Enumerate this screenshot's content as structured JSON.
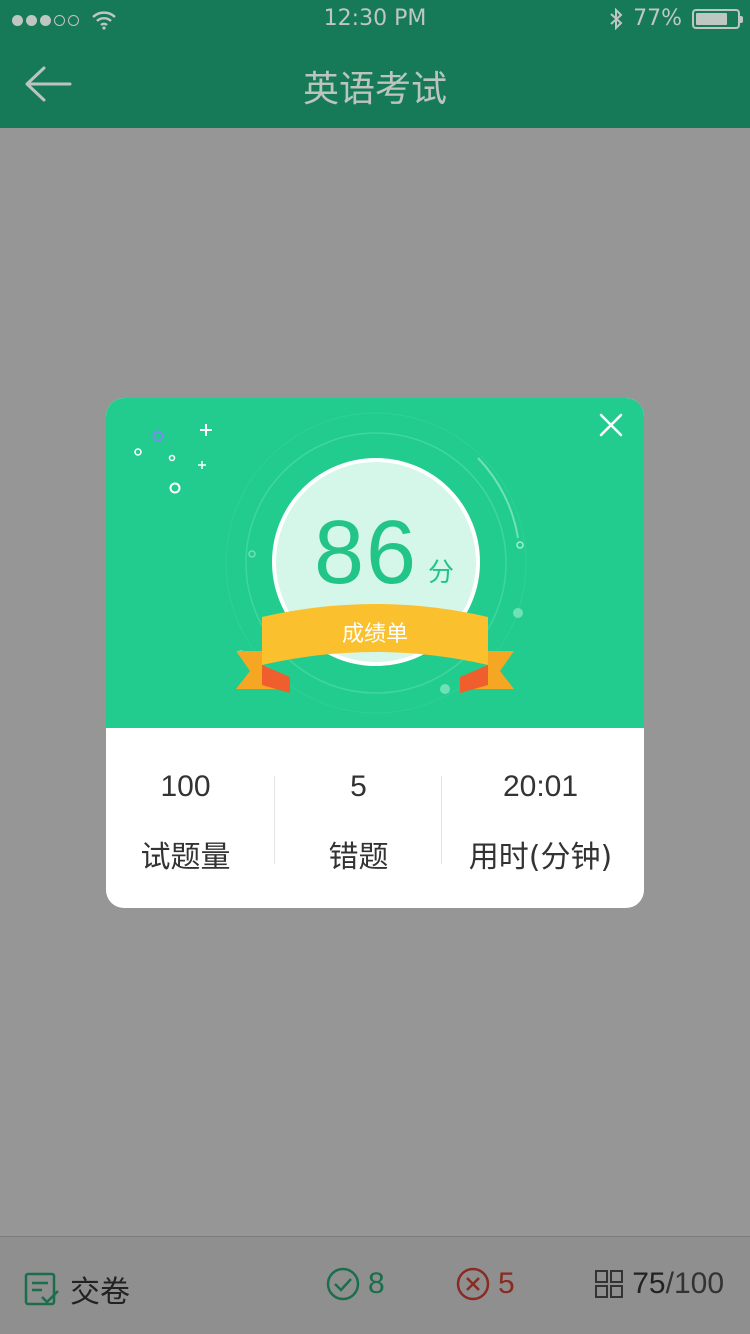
{
  "status_bar": {
    "time": "12:30 PM",
    "battery_text": "77%",
    "battery_level": 0.77
  },
  "nav": {
    "title": "英语考试",
    "back_icon": "arrow-left-icon"
  },
  "result_card": {
    "score": "86",
    "score_unit": "分",
    "ribbon_label": "成绩单",
    "close_icon": "close-icon",
    "stats": [
      {
        "value": "100",
        "label": "试题量"
      },
      {
        "value": "5",
        "label": "错题"
      },
      {
        "value": "20:01",
        "label": "用时(分钟)"
      }
    ]
  },
  "bottom_bar": {
    "submit_label": "交卷",
    "correct_count": "8",
    "wrong_count": "5",
    "progress_current": "75",
    "progress_total": "/100"
  },
  "colors": {
    "brand": "#167a58",
    "card_green": "#22cc8e",
    "score_green": "#22c488",
    "ribbon": "#f9be22",
    "correct": "#1a6e4c",
    "wrong": "#8a2b21"
  }
}
